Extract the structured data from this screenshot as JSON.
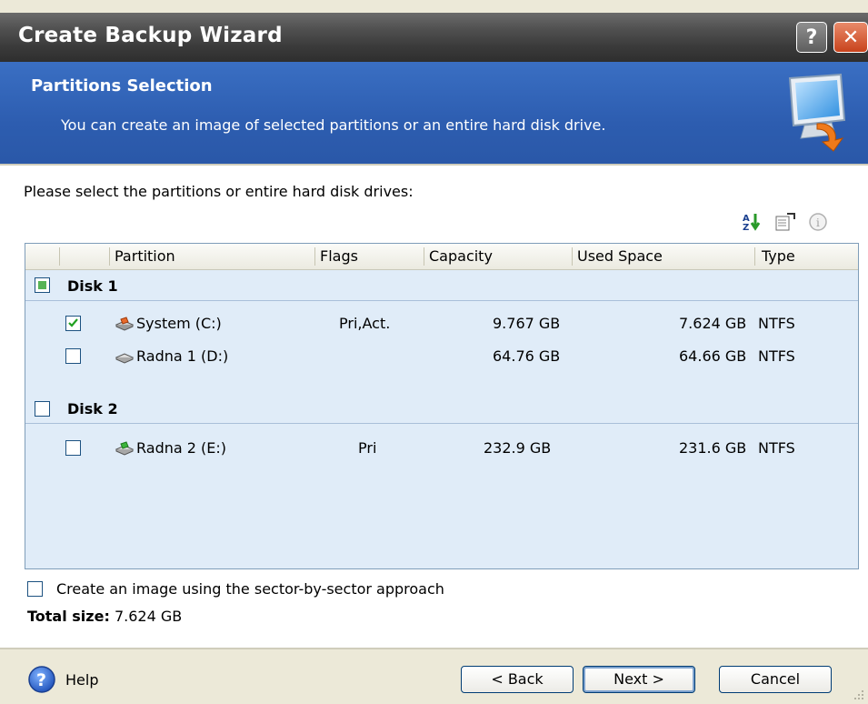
{
  "window": {
    "title": "Create Backup Wizard",
    "help_btn": "?",
    "close_btn": "✕"
  },
  "header": {
    "title": "Partitions Selection",
    "subtitle": "You can create an image of selected partitions or an entire hard disk drive."
  },
  "instruction": "Please select the partitions or entire hard disk drives:",
  "toolbar_icons": [
    "sort-icon",
    "properties-icon",
    "info-icon"
  ],
  "list": {
    "columns": [
      "Partition",
      "Flags",
      "Capacity",
      "Used Space",
      "Type"
    ],
    "disks": [
      {
        "label": "Disk 1",
        "state": "partial",
        "partitions": [
          {
            "name": "System (C:)",
            "flags": "Pri,Act.",
            "capacity": "9.767 GB",
            "used_space": "7.624 GB",
            "type": "NTFS",
            "checked": true
          },
          {
            "name": "Radna 1 (D:)",
            "flags": "",
            "capacity": "64.76 GB",
            "used_space": "64.66 GB",
            "type": "NTFS",
            "checked": false
          }
        ]
      },
      {
        "label": "Disk 2",
        "state": "unchecked",
        "partitions": [
          {
            "name": "Radna 2 (E:)",
            "flags": "Pri",
            "capacity": "232.9 GB",
            "used_space": "231.6 GB",
            "type": "NTFS",
            "checked": false
          }
        ]
      }
    ]
  },
  "sector_option": {
    "label": "Create an image using the sector-by-sector approach",
    "checked": false
  },
  "total": {
    "label": "Total size:",
    "value": "7.624 GB"
  },
  "footer": {
    "help": "Help",
    "back": "< Back",
    "next": "Next >",
    "cancel": "Cancel"
  },
  "colors": {
    "header_blue": "#2d5db0",
    "list_bg": "#e0ecf8",
    "titlebar": "#3a3a3a",
    "close_red": "#c8431c"
  }
}
